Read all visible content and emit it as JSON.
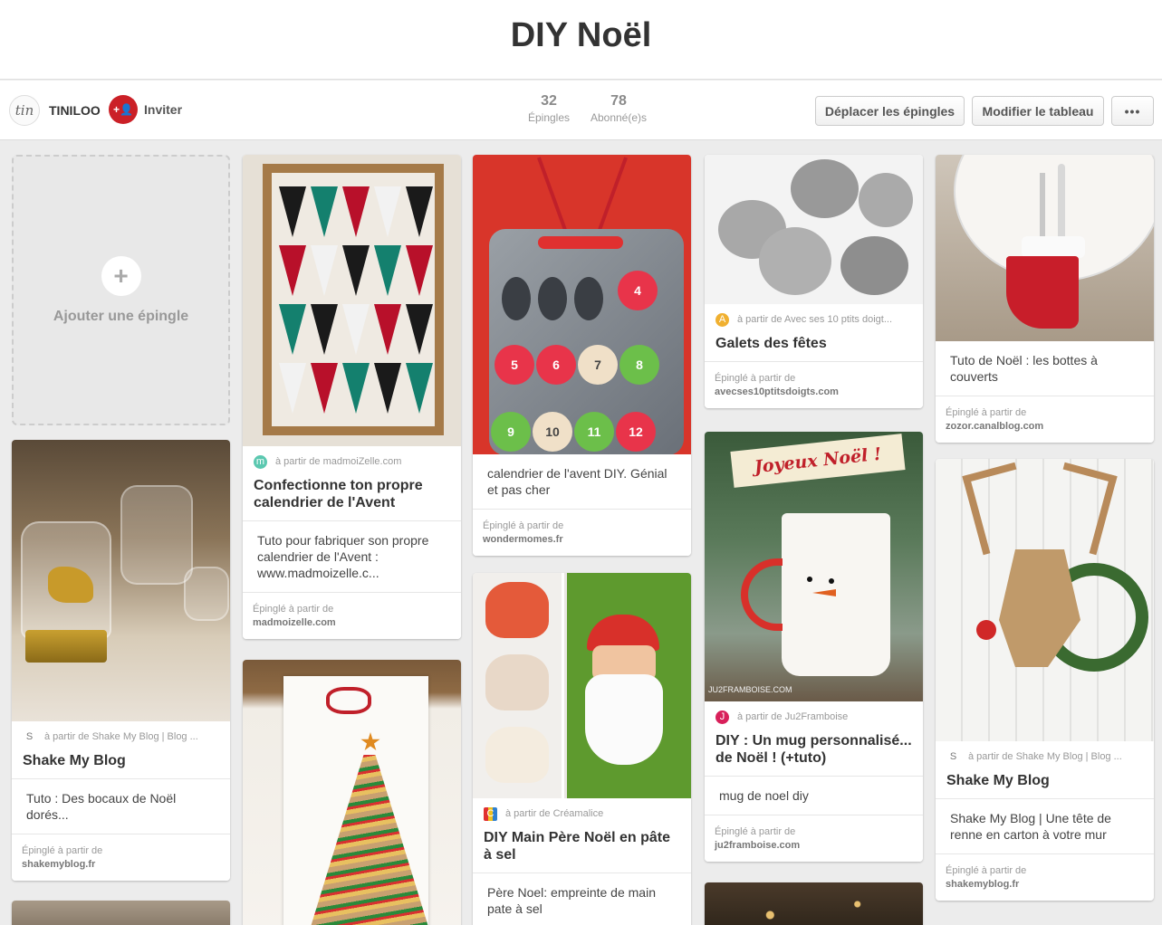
{
  "board": {
    "title": "DIY Noël",
    "owner": {
      "name": "TINILOO",
      "avatar_text": "tin"
    },
    "invite_label": "Inviter",
    "invite_icon": "+👤",
    "stats": {
      "pins_count": "32",
      "pins_label": "Épingles",
      "followers_count": "78",
      "followers_label": "Abonné(e)s"
    },
    "buttons": {
      "move_pins": "Déplacer les épingles",
      "edit_board": "Modifier le tableau",
      "more": "•••"
    }
  },
  "add_pin": {
    "plus": "+",
    "label": "Ajouter une épingle"
  },
  "pins": [
    {
      "source": "à partir de madmoiZelle.com",
      "source_icon": "m",
      "title": "Confectionne ton propre calendrier de l'Avent",
      "description": "Tuto pour fabriquer son propre calendrier de l'Avent : www.madmoizelle.c...",
      "pinned_label": "Épinglé à partir de",
      "domain": "madmoizelle.com"
    },
    {
      "source": "à partir de Shake My Blog | Blog ...",
      "source_icon": "S",
      "title": "Shake My Blog",
      "description": "Tuto : Des bocaux de Noël dorés...",
      "pinned_label": "Épinglé à partir de",
      "domain": "shakemyblog.fr"
    },
    {
      "source": "",
      "title": "",
      "description": "calendrier de l'avent DIY. Génial et pas cher",
      "pinned_label": "Épinglé à partir de",
      "domain": "wondermomes.fr"
    },
    {
      "source": "à partir de Créamalice",
      "source_icon": "C",
      "title": "DIY Main Père Noël en pâte à sel",
      "description": "Père Noel: empreinte de main pate à sel",
      "pinned_label": "",
      "domain": ""
    },
    {
      "source": "à partir de Avec ses 10 ptits doigt...",
      "source_icon": "A",
      "title": "Galets des fêtes",
      "description": "",
      "pinned_label": "Épinglé à partir de",
      "domain": "avecses10ptitsdoigts.com"
    },
    {
      "source": "à partir de Ju2Framboise",
      "source_icon": "J",
      "title": "DIY : Un mug personnalisé... de Noël ! (+tuto)",
      "description": "mug de noel diy",
      "pinned_label": "Épinglé à partir de",
      "domain": "ju2framboise.com"
    },
    {
      "source": "",
      "title": "",
      "description": "Tuto de Noël : les bottes à couverts",
      "pinned_label": "Épinglé à partir de",
      "domain": "zozor.canalblog.com"
    },
    {
      "source": "à partir de Shake My Blog | Blog ...",
      "source_icon": "S",
      "title": "Shake My Blog",
      "description": "Shake My Blog | Une tête de renne en carton à votre mur",
      "pinned_label": "Épinglé à partir de",
      "domain": "shakemyblog.fr"
    }
  ],
  "image_text": {
    "advent_numbers": [
      "4",
      "5",
      "6",
      "7",
      "8",
      "9",
      "10",
      "11",
      "12"
    ],
    "mug_banner": "Joyeux Noël !",
    "mug_watermark": "JU2FRAMBOISE.COM"
  },
  "colors": {
    "brand_red": "#cb2027",
    "background": "#ececec"
  }
}
